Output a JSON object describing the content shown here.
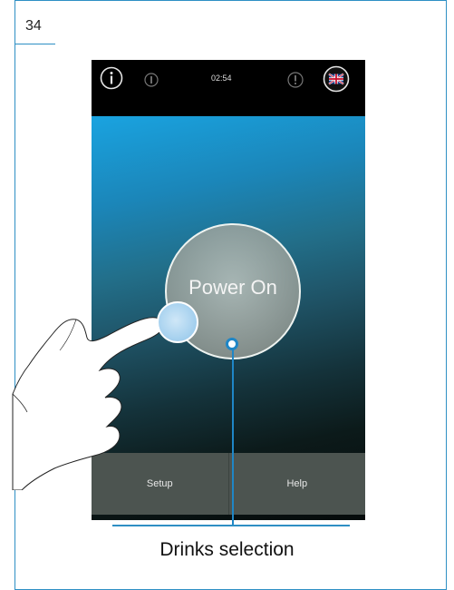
{
  "page": {
    "number": "34"
  },
  "status_bar": {
    "time": "02:54"
  },
  "main": {
    "power_button_label": "Power On"
  },
  "bottom_bar": {
    "setup_label": "Setup",
    "help_label": "Help"
  },
  "annotation": {
    "caption": "Drinks selection"
  },
  "colors": {
    "accent": "#2e8fc4",
    "touch_indicator": "#a8d2ef",
    "bottom_bar": "#4c5450"
  },
  "icons": [
    "info-icon",
    "signal-icon",
    "alert-icon",
    "uk-flag-icon",
    "pointing-hand-icon"
  ]
}
